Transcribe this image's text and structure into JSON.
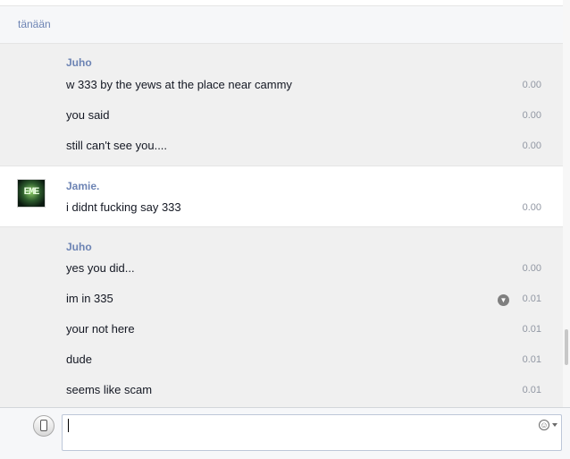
{
  "date_separator": "tänään",
  "groups": [
    {
      "sender": "Juho",
      "avatar": false,
      "messages": [
        {
          "text": "w 333 by the yews at the place near cammy",
          "time": "0.00"
        },
        {
          "text": "you said",
          "time": "0.00"
        },
        {
          "text": "still can't see you....",
          "time": "0.00"
        }
      ]
    },
    {
      "sender": "Jamie.",
      "avatar": true,
      "avatar_text": "EME",
      "messages": [
        {
          "text": "i didnt fucking say 333",
          "time": "0.00"
        }
      ]
    },
    {
      "sender": "Juho",
      "avatar": false,
      "messages": [
        {
          "text": "yes you did...",
          "time": "0.00"
        },
        {
          "text": "im in 335",
          "time": "0.01",
          "has_menu_icon": true
        },
        {
          "text": "your not here",
          "time": "0.01"
        },
        {
          "text": "dude",
          "time": "0.01"
        },
        {
          "text": "seems like scam",
          "time": "0.01"
        }
      ]
    }
  ],
  "composer": {
    "value": "",
    "icons": {
      "device": "mobile-phone-icon",
      "emoji": "smiley-face-icon"
    }
  },
  "colors": {
    "sender_name": "#6d84b4",
    "timestamp": "#9197a3",
    "group_bg_alt": "#f0f0f0"
  }
}
